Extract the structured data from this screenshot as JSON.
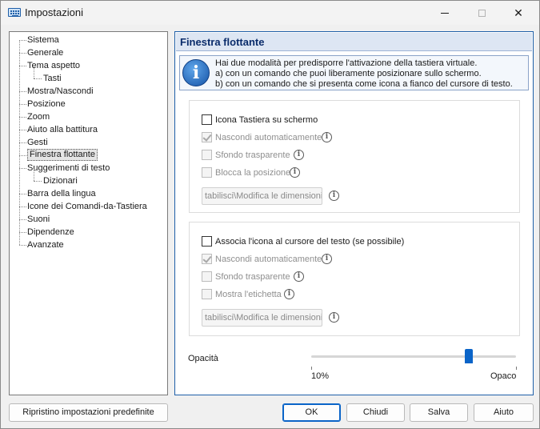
{
  "window": {
    "title": "Impostazioni",
    "minimize_symbol": "—",
    "maximize_symbol": "☐",
    "close_symbol": "✕"
  },
  "tree": {
    "items": [
      {
        "label": "Sistema",
        "level": 0
      },
      {
        "label": "Generale",
        "level": 0
      },
      {
        "label": "Tema aspetto",
        "level": 0
      },
      {
        "label": "Tasti",
        "level": 1
      },
      {
        "label": "Mostra/Nascondi",
        "level": 0
      },
      {
        "label": "Posizione",
        "level": 0
      },
      {
        "label": "Zoom",
        "level": 0
      },
      {
        "label": "Aiuto alla battitura",
        "level": 0
      },
      {
        "label": "Gesti",
        "level": 0
      },
      {
        "label": "Finestra flottante",
        "level": 0,
        "selected": true
      },
      {
        "label": "Suggerimenti di testo",
        "level": 0
      },
      {
        "label": "Dizionari",
        "level": 1
      },
      {
        "label": "Barra della lingua",
        "level": 0
      },
      {
        "label": "Icone dei Comandi-da-Tastiera",
        "level": 0
      },
      {
        "label": "Suoni",
        "level": 0
      },
      {
        "label": "Dipendenze",
        "level": 0
      },
      {
        "label": "Avanzate",
        "level": 0
      }
    ]
  },
  "panel": {
    "title": "Finestra flottante",
    "info_lines": [
      "Hai due modalità per predisporre l'attivazione della tastiera virtuale.",
      "a) con un comando che puoi liberamente posizionare sullo schermo.",
      "b) con un comando che si presenta come icona a fianco del cursore di testo."
    ],
    "info_icon": "i",
    "group1": {
      "main_checkbox": {
        "label": "Icona Tastiera su schermo",
        "checked": false
      },
      "options": [
        {
          "label": "Nascondi automaticamente",
          "checked": true
        },
        {
          "label": "Sfondo trasparente",
          "checked": false
        },
        {
          "label": "Blocca la posizione",
          "checked": false
        }
      ],
      "button_label": "tabilisci\\Modifica le dimensioni..."
    },
    "group2": {
      "main_checkbox": {
        "label": "Associa l'icona al cursore del testo (se possibile)",
        "checked": false
      },
      "options": [
        {
          "label": "Nascondi automaticamente",
          "checked": true
        },
        {
          "label": "Sfondo trasparente",
          "checked": false
        },
        {
          "label": "Mostra l'etichetta",
          "checked": false
        }
      ],
      "button_label": "tabilisci\\Modifica le dimensioni..."
    },
    "opacity": {
      "label": "Opacità",
      "min_label": "10%",
      "max_label": "Opaco",
      "value_fraction": 0.77
    },
    "info_button_glyph": "i"
  },
  "footer": {
    "reset_label": "Ripristino impostazioni predefinite",
    "ok_label": "OK",
    "close_label": "Chiudi",
    "save_label": "Salva",
    "help_label": "Aiuto"
  },
  "colors": {
    "accent": "#0a64c8",
    "panel_header": "#dde6f3",
    "title_text": "#0a2c6b"
  }
}
